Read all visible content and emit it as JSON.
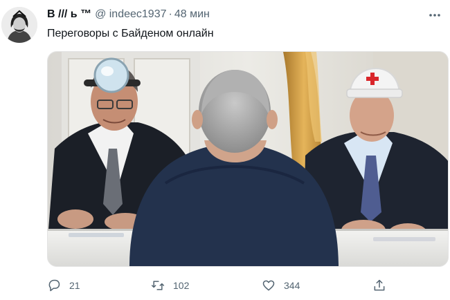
{
  "tweet": {
    "display_name": "В /// ь ™",
    "handle": "@ indeec1937",
    "separator": "·",
    "time": "48 мин",
    "text": "Переговоры с Байденом онлайн",
    "avatar_icon": "user-avatar-icon",
    "more_icon": "more-dots-icon",
    "actions": {
      "reply": {
        "icon": "reply-icon",
        "count": "21"
      },
      "retweet": {
        "icon": "retweet-icon",
        "count": "102"
      },
      "like": {
        "icon": "heart-icon",
        "count": "344"
      },
      "share": {
        "icon": "share-icon"
      }
    }
  },
  "colors": {
    "text_primary": "#0f1419",
    "text_secondary": "#536471"
  }
}
